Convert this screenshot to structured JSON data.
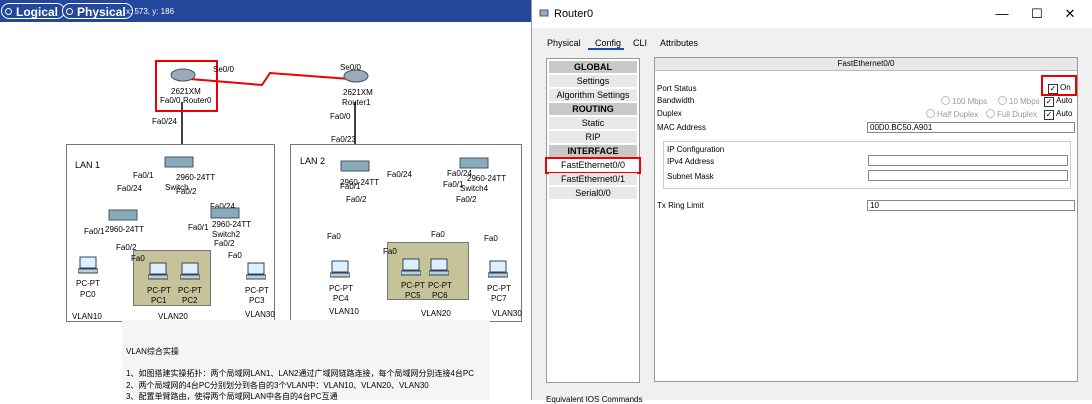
{
  "workspace": {
    "logical_label": "Logical",
    "physical_label": "Physical",
    "coords": "x: 573, y: 186",
    "router0": {
      "model": "2621XM",
      "name": "Router0",
      "port_serial": "Se0/0",
      "port_fa": "Fa0/0"
    },
    "router1": {
      "model": "2621XM",
      "name": "Router1",
      "port_serial": "Se0/0",
      "port_fa": "Fa0/0"
    },
    "links": {
      "r0_down": "Fa0/24",
      "r1_down": "Fa0/23"
    },
    "lan1": {
      "title": "LAN 1",
      "core_switch": "2960-24TT",
      "core_switch_name": "Switch",
      "core_ports": [
        "Fa0/1",
        "Fa0/2",
        "Fa0/24",
        "Fa0/24"
      ],
      "left_switch": "2960-24TT",
      "left_ports": [
        "Fa0/1",
        "Fa0/2",
        "Fa0"
      ],
      "right_switch": "2960-24TT",
      "right_switch_name": "Switch2",
      "right_ports": [
        "Fa0/1",
        "Fa0/2",
        "Fa0"
      ],
      "pcs": [
        {
          "type": "PC-PT",
          "name": "PC0"
        },
        {
          "type": "PC-PT",
          "name": "PC1"
        },
        {
          "type": "PC-PT",
          "name": "PC2"
        },
        {
          "type": "PC-PT",
          "name": "PC3"
        }
      ],
      "vlans": [
        "VLAN10",
        "VLAN20",
        "VLAN30"
      ]
    },
    "lan2": {
      "title": "LAN 2",
      "left_switch": "2960-24TT",
      "left_ports": [
        "Fa0/1",
        "Fa0/2",
        "Fa0/24"
      ],
      "right_switch": "2960-24TT",
      "right_switch_name": "Switch4",
      "right_ports": [
        "Fa0/24",
        "Fa0/1",
        "Fa0/2"
      ],
      "pc_ports": [
        "Fa0",
        "Fa0",
        "Fa0",
        "Fa0"
      ],
      "pcs": [
        {
          "type": "PC-PT",
          "name": "PC4"
        },
        {
          "type": "PC-PT",
          "name": "PC5"
        },
        {
          "type": "PC-PT",
          "name": "PC6"
        },
        {
          "type": "PC-PT",
          "name": "PC7"
        }
      ],
      "vlans": [
        "VLAN10",
        "VLAN20",
        "VLAN30"
      ]
    },
    "notes": {
      "title": "VLAN综合实操",
      "line1": "1、如图搭建实操拓扑：两个局域网LAN1、LAN2通过广域网链路连接，每个局域网分别连接4台PC",
      "line2": "2、两个局域网的4台PC分别划分到各自的3个VLAN中：VLAN10、VLAN20、VLAN30",
      "line3": "3、配置单臂路由，使得两个局域网LAN中各自的4台PC互通"
    }
  },
  "router_window": {
    "title": "Router0",
    "tabs": [
      "Physical",
      "Config",
      "CLI",
      "Attributes"
    ],
    "active_tab": "Config",
    "sidebar": {
      "global_head": "GLOBAL",
      "settings": "Settings",
      "algorithm": "Algorithm Settings",
      "routing_head": "ROUTING",
      "static": "Static",
      "rip": "RIP",
      "interface_head": "INTERFACE",
      "fa00": "FastEthernet0/0",
      "fa01": "FastEthernet0/1",
      "serial": "Serial0/0"
    },
    "panel": {
      "header": "FastEthernet0/0",
      "port_status_label": "Port Status",
      "on_label": "On",
      "bandwidth_label": "Bandwidth",
      "bw_100": "100 Mbps",
      "bw_10": "10 Mbps",
      "auto1": "Auto",
      "duplex_label": "Duplex",
      "half": "Half Duplex",
      "full": "Full Duplex",
      "auto2": "Auto",
      "mac_label": "MAC Address",
      "mac_value": "00D0.BC50.A901",
      "ip_config_label": "IP Configuration",
      "ipv4_label": "IPv4 Address",
      "ipv4_value": "",
      "mask_label": "Subnet Mask",
      "mask_value": "",
      "tx_label": "Tx Ring Limit",
      "tx_value": "10"
    },
    "bottom_text": "Equivalent IOS Commands"
  },
  "colors": {
    "topbar": "#24479c",
    "highlight": "#e00000",
    "vlan_box": "#c6c39b"
  }
}
